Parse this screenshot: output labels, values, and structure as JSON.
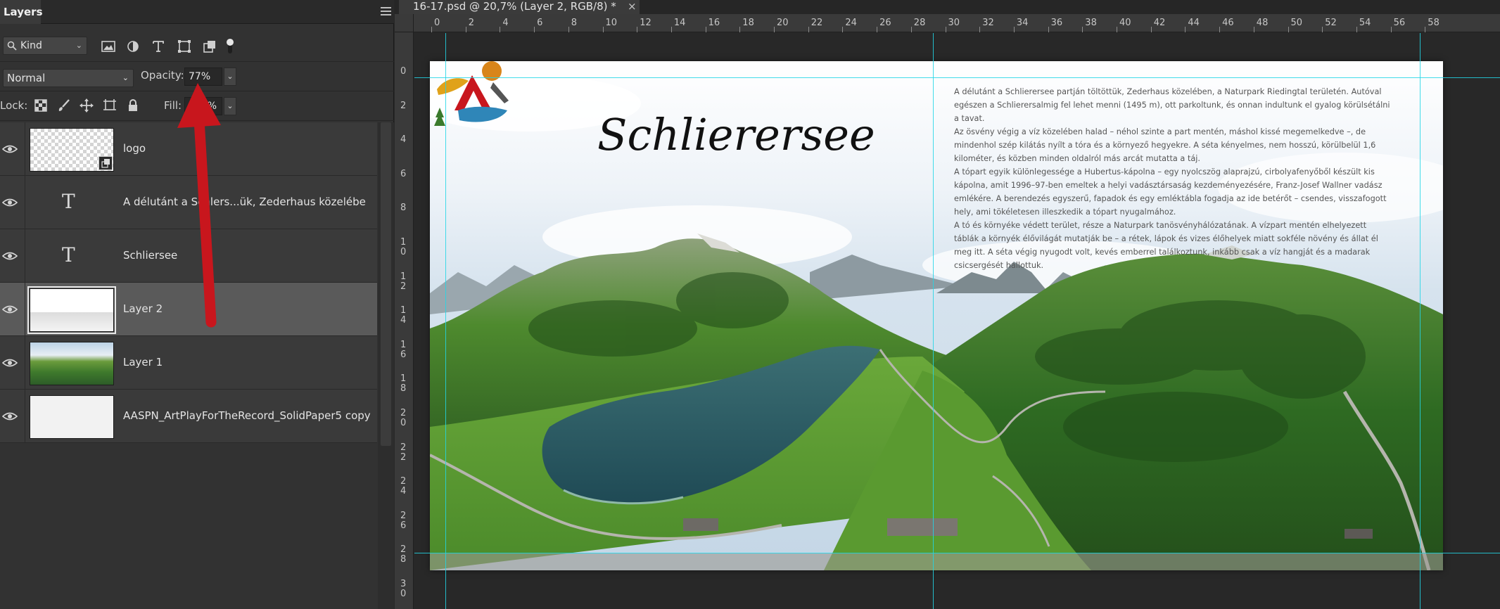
{
  "panel": {
    "title": "Layers",
    "filter_kind": "Kind",
    "blend_mode": "Normal",
    "opacity_label": "Opacity:",
    "opacity_value": "77%",
    "lock_label": "Lock:",
    "fill_label": "Fill:",
    "fill_value": "100%"
  },
  "layers": [
    {
      "name": "logo",
      "type": "smart-object",
      "visible": true,
      "selected": false
    },
    {
      "name": "A délutánt a Schlers...ük, Zederhaus közelébe",
      "type": "text",
      "visible": true,
      "selected": false
    },
    {
      "name": "Schliersee",
      "type": "text",
      "visible": true,
      "selected": false
    },
    {
      "name": "Layer 2",
      "type": "pixel",
      "visible": true,
      "selected": true
    },
    {
      "name": "Layer 1",
      "type": "pixel",
      "visible": true,
      "selected": false
    },
    {
      "name": "AASPN_ArtPlayForTheRecord_SolidPaper5 copy",
      "type": "pixel",
      "visible": true,
      "selected": false
    }
  ],
  "document": {
    "tab_title": "16-17.psd @ 20,7% (Layer 2, RGB/8) *",
    "close_glyph": "×",
    "ruler_h_labels": [
      "0",
      "2",
      "4",
      "6",
      "8",
      "10",
      "12",
      "14",
      "16",
      "18",
      "20",
      "22",
      "24",
      "26",
      "28",
      "30",
      "32",
      "34",
      "36",
      "38",
      "40",
      "42",
      "44",
      "46",
      "48",
      "50",
      "52",
      "54",
      "56",
      "58"
    ],
    "ruler_v_labels": [
      "0",
      "2",
      "4",
      "6",
      "8",
      "10",
      "12",
      "14",
      "16",
      "18",
      "20",
      "22",
      "24",
      "26",
      "28",
      "30"
    ],
    "logo_title": "Schlierersee",
    "paragraphs": [
      "A délutánt a Schlierersee partján töltöttük, Zederhaus közelében, a Naturpark Riedingtal területén. Autóval egészen a Schlierersalmig fel lehet menni (1495 m), ott parkoltunk, és onnan indultunk el gyalog körülsétálni a tavat.",
      "Az ösvény végig a víz közelében halad – néhol szinte a part mentén, máshol kissé megemelkedve –, de mindenhol szép kilátás nyílt a tóra és a környező hegyekre. A séta kényelmes, nem hosszú, körülbelül 1,6 kilométer, és közben minden oldalról más arcát mutatta a táj.",
      "A tópart egyik különlegessége a Hubertus-kápolna – egy nyolcszög alaprajzú, cirbolyafenyőből készült kis kápolna, amit 1996–97-ben emeltek a helyi vadásztársaság kezdeményezésére, Franz-Josef Wallner vadász emlékére. A berendezés egyszerű, fapadok és egy emléktábla fogadja az ide betérőt – csendes, visszafogott hely, ami tökéletesen illeszkedik a tópart nyugalmához.",
      "A tó és környéke védett terület, része a Naturpark tanösvényhálózatának. A vízpart mentén elhelyezett táblák a környék élővilágát mutatják be – a rétek, lápok és vizes élőhelyek miatt sokféle növény és állat él meg itt. A séta végig nyugodt volt, kevés emberrel találkoztunk, inkább csak a víz hangját és a madarak csicsergését hallottuk."
    ]
  },
  "colors": {
    "guide": "#22d6e6",
    "annotation_arrow": "#c8161d",
    "panel_bg": "#323232",
    "selected_row": "#5a5a5a"
  }
}
